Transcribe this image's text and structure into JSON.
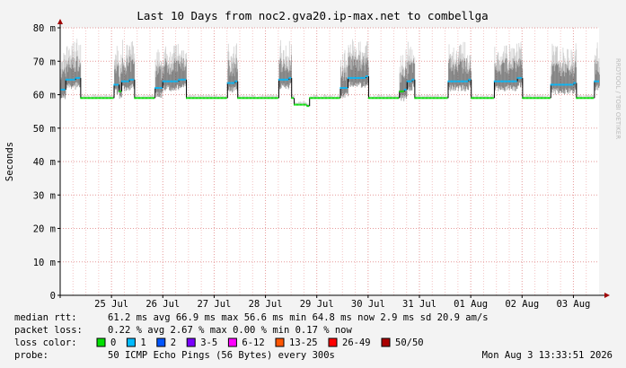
{
  "chart_data": {
    "type": "line",
    "title": "Last 10 Days from noc2.gva20.ip-max.net to combellga",
    "ylabel": "Seconds",
    "side_label": "RRDTOOL / TOBI OETIKER",
    "ylim": [
      0,
      80
    ],
    "y_ticks": [
      "0",
      "10 m",
      "20 m",
      "30 m",
      "40 m",
      "50 m",
      "60 m",
      "70 m",
      "80 m"
    ],
    "x_range_days": [
      0,
      10.5
    ],
    "x_ticks": [
      {
        "day": 1,
        "label": "25 Jul"
      },
      {
        "day": 2,
        "label": "26 Jul"
      },
      {
        "day": 3,
        "label": "27 Jul"
      },
      {
        "day": 4,
        "label": "28 Jul"
      },
      {
        "day": 5,
        "label": "29 Jul"
      },
      {
        "day": 6,
        "label": "30 Jul"
      },
      {
        "day": 7,
        "label": "31 Jul"
      },
      {
        "day": 8,
        "label": "01 Aug"
      },
      {
        "day": 9,
        "label": "02 Aug"
      },
      {
        "day": 10,
        "label": "03 Aug"
      }
    ],
    "median_rtt_ms": [
      [
        0.0,
        61.5
      ],
      [
        0.1,
        64.5
      ],
      [
        0.3,
        65.0
      ],
      [
        0.4,
        59.0
      ],
      [
        0.95,
        59.0
      ],
      [
        1.05,
        63.0
      ],
      [
        1.15,
        61.0
      ],
      [
        1.2,
        64.0
      ],
      [
        1.35,
        64.5
      ],
      [
        1.45,
        59.0
      ],
      [
        1.75,
        59.0
      ],
      [
        1.85,
        62.0
      ],
      [
        2.0,
        64.0
      ],
      [
        2.3,
        64.5
      ],
      [
        2.45,
        59.0
      ],
      [
        3.2,
        59.0
      ],
      [
        3.25,
        63.5
      ],
      [
        3.4,
        64.0
      ],
      [
        3.45,
        59.0
      ],
      [
        4.2,
        59.0
      ],
      [
        4.25,
        64.5
      ],
      [
        4.45,
        65.0
      ],
      [
        4.5,
        59.0
      ],
      [
        4.55,
        57.0
      ],
      [
        4.8,
        56.6
      ],
      [
        4.85,
        59.0
      ],
      [
        5.35,
        59.0
      ],
      [
        5.45,
        62.0
      ],
      [
        5.6,
        65.0
      ],
      [
        5.95,
        65.5
      ],
      [
        6.0,
        59.0
      ],
      [
        6.5,
        59.0
      ],
      [
        6.6,
        61.0
      ],
      [
        6.7,
        61.5
      ],
      [
        6.75,
        64.0
      ],
      [
        6.85,
        64.5
      ],
      [
        6.9,
        59.0
      ],
      [
        7.5,
        59.0
      ],
      [
        7.55,
        64.0
      ],
      [
        7.95,
        64.5
      ],
      [
        8.0,
        59.0
      ],
      [
        8.4,
        59.0
      ],
      [
        8.45,
        64.0
      ],
      [
        8.9,
        65.0
      ],
      [
        9.0,
        59.0
      ],
      [
        9.5,
        59.0
      ],
      [
        9.55,
        63.0
      ],
      [
        10.0,
        63.5
      ],
      [
        10.05,
        59.0
      ],
      [
        10.35,
        59.0
      ],
      [
        10.4,
        64.0
      ],
      [
        10.5,
        64.0
      ]
    ],
    "loss_legend": [
      {
        "label": "0",
        "color": "#00e000"
      },
      {
        "label": "1",
        "color": "#00bbff"
      },
      {
        "label": "2",
        "color": "#0055ff"
      },
      {
        "label": "3-5",
        "color": "#7a00ff"
      },
      {
        "label": "6-12",
        "color": "#ff00ff"
      },
      {
        "label": "13-25",
        "color": "#ff5500"
      },
      {
        "label": "26-49",
        "color": "#ff0000"
      },
      {
        "label": "50/50",
        "color": "#aa0000"
      }
    ]
  },
  "stats": {
    "median_label": "median rtt:",
    "median_values": "61.2 ms avg   66.9 ms max   56.6 ms min   64.8 ms now   2.9 ms sd   20.9   am/s",
    "loss_label": "packet loss:",
    "loss_values": "0.22 % avg   2.67 % max   0.00 % min   0.17 % now",
    "color_label": "loss color:",
    "probe_label": "probe:",
    "probe_values": "50 ICMP Echo Pings (56 Bytes) every 300s",
    "timestamp": "Mon Aug  3 13:33:51 2026"
  }
}
